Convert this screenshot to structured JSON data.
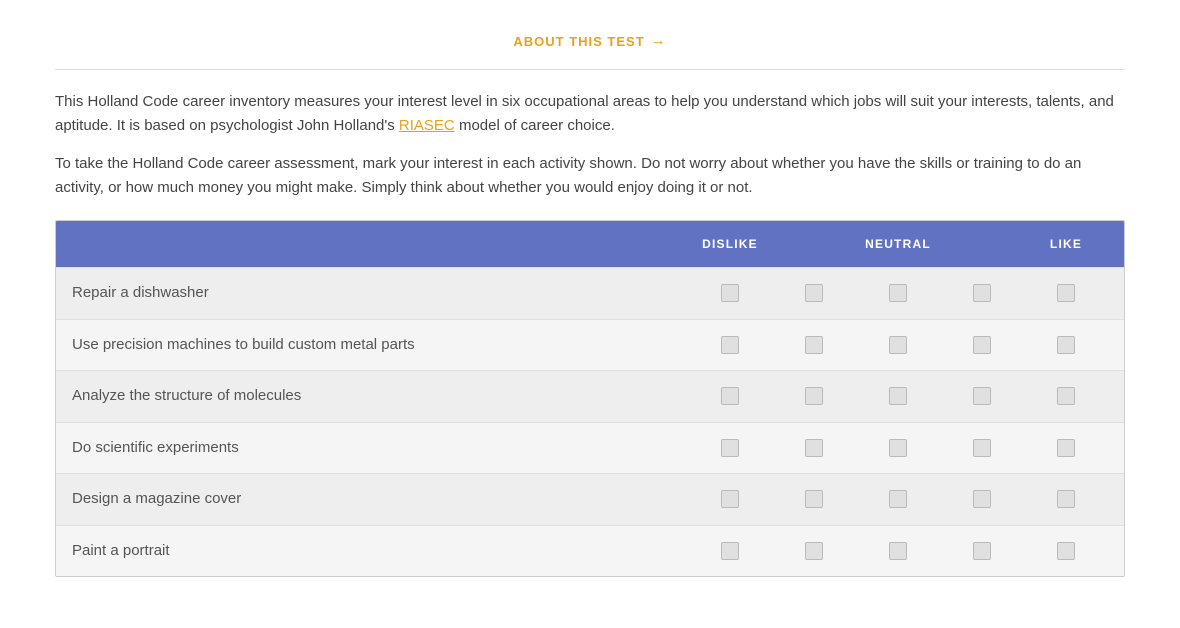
{
  "header": {
    "about_link": "ABOUT THIS TEST",
    "arrow": "→"
  },
  "intro": {
    "paragraph1": "This Holland Code career inventory measures your interest level in six occupational areas to help you understand which jobs will suit your interests, talents, and aptitude. It is based on psychologist John Holland's ",
    "riasec": "RIASEC",
    "paragraph1_end": " model of career choice.",
    "paragraph2": "To take the Holland Code career assessment, mark your interest in each activity shown. Do not worry about whether you have the skills or training to do an activity, or how much money you might make. Simply think about whether you would enjoy doing it or not."
  },
  "table": {
    "col_dislike": "DISLIKE",
    "col_neutral": "NEUTRAL",
    "col_like": "LIKE",
    "activities": [
      "Repair a dishwasher",
      "Use precision machines to build custom metal parts",
      "Analyze the structure of molecules",
      "Do scientific experiments",
      "Design a magazine cover",
      "Paint a portrait"
    ]
  }
}
